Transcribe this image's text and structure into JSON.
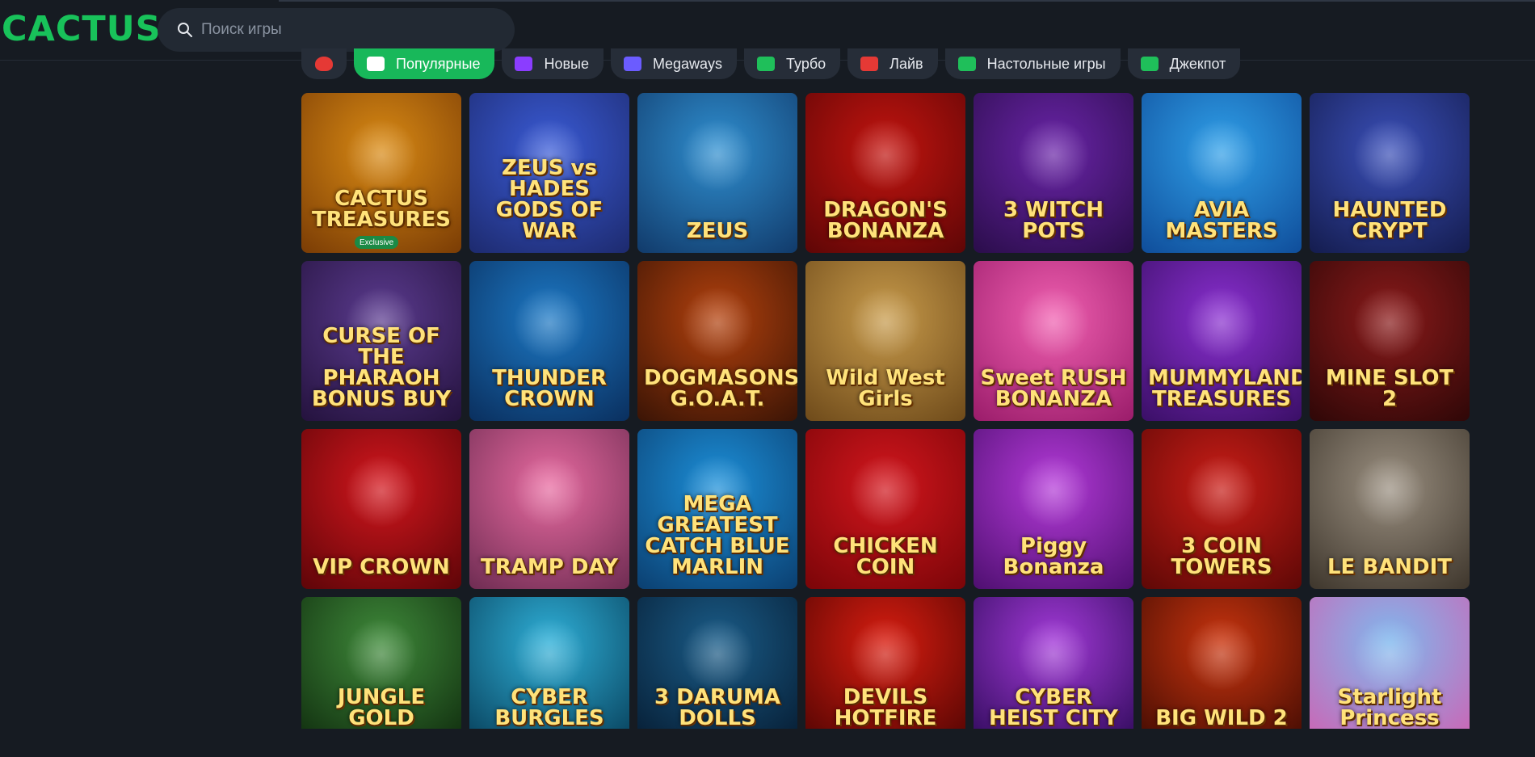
{
  "logo": {
    "text": "CACTUS"
  },
  "search": {
    "placeholder": "Поиск игры"
  },
  "colors": {
    "accent": "#18c25a",
    "background": "#161b22",
    "chip": "#262d38"
  },
  "categories": [
    {
      "label": "",
      "icon": "heart-icon",
      "color": "#e53935"
    },
    {
      "label": "Популярные",
      "icon": "trophy-icon",
      "color": "#ffffff",
      "active": true
    },
    {
      "label": "Новые",
      "icon": "sparkle-icon",
      "color": "#8b3dff"
    },
    {
      "label": "Megaways",
      "icon": "megaways-icon",
      "color": "#6b5cff"
    },
    {
      "label": "Турбо",
      "icon": "lightning-icon",
      "color": "#1fbf5a"
    },
    {
      "label": "Лайв",
      "icon": "live-icon",
      "color": "#e53935"
    },
    {
      "label": "Настольные игры",
      "icon": "chip-icon",
      "color": "#1fbf5a"
    },
    {
      "label": "Джекпот",
      "icon": "diamond-icon",
      "color": "#1fbf5a"
    }
  ],
  "games": [
    {
      "title": "CACTUS TREASURES",
      "badge": "Exclusive",
      "bg": "#d98a14",
      "bg2": "#7a3c05"
    },
    {
      "title": "ZEUS vs HADES GODS OF WAR",
      "bg": "#3a5bd6",
      "bg2": "#1d2a6e"
    },
    {
      "title": "ZEUS",
      "bg": "#2f8fd0",
      "bg2": "#113a6a"
    },
    {
      "title": "DRAGON'S BONANZA",
      "bg": "#c2140f",
      "bg2": "#5e0606"
    },
    {
      "title": "3 WITCH POTS",
      "bg": "#6a24a8",
      "bg2": "#2a0d4a"
    },
    {
      "title": "AVIA MASTERS",
      "bg": "#2f9fe8",
      "bg2": "#0f4d9a"
    },
    {
      "title": "HAUNTED CRYPT",
      "bg": "#3a4fb8",
      "bg2": "#141c4e"
    },
    {
      "title": "CURSE OF THE PHARAOH BONUS BUY",
      "bg": "#5b3b8f",
      "bg2": "#24123d"
    },
    {
      "title": "THUNDER CROWN",
      "bg": "#1c78c4",
      "bg2": "#0a2f5e"
    },
    {
      "title": "DOGMASONS G.O.A.T.",
      "bg": "#b3410d",
      "bg2": "#3a1405"
    },
    {
      "title": "Wild West Girls",
      "bg": "#c79a4a",
      "bg2": "#6e4a1a"
    },
    {
      "title": "Sweet RUSH BONANZA",
      "bg": "#f05fb0",
      "bg2": "#9a1c6a"
    },
    {
      "title": "MUMMYLAND TREASURES",
      "bg": "#8a2fd0",
      "bg2": "#3a0f66"
    },
    {
      "title": "MINE SLOT 2",
      "bg": "#8a1a1a",
      "bg2": "#2e0707"
    },
    {
      "title": "VIP CROWN",
      "bg": "#d2161d",
      "bg2": "#5e0508"
    },
    {
      "title": "TRAMP DAY",
      "bg": "#e86aa0",
      "bg2": "#6e2c52"
    },
    {
      "title": "MEGA GREATEST CATCH BLUE MARLIN",
      "bg": "#1c8fd8",
      "bg2": "#0b3f70"
    },
    {
      "title": "CHICKEN COIN",
      "bg": "#d2161d",
      "bg2": "#7a0508"
    },
    {
      "title": "Piggy Bonanza",
      "bg": "#b43ad8",
      "bg2": "#4e0f70"
    },
    {
      "title": "3 COIN TOWERS",
      "bg": "#c91d17",
      "bg2": "#5e0806"
    },
    {
      "title": "LE BANDIT",
      "bg": "#9a8f80",
      "bg2": "#3e362c"
    },
    {
      "title": "JUNGLE GOLD",
      "bg": "#3f8a3a",
      "bg2": "#143512"
    },
    {
      "title": "CYBER BURGLES",
      "bg": "#2fb0d8",
      "bg2": "#0b4a66"
    },
    {
      "title": "3 DARUMA DOLLS",
      "bg": "#1a5c88",
      "bg2": "#08223a"
    },
    {
      "title": "DEVILS HOTFIRE",
      "bg": "#d81d10",
      "bg2": "#5e0704"
    },
    {
      "title": "CYBER HEIST CITY",
      "bg": "#a33ad8",
      "bg2": "#3a0f66"
    },
    {
      "title": "BIG WILD 2",
      "bg": "#c9340e",
      "bg2": "#4e0f04"
    },
    {
      "title": "Starlight Princess",
      "bg": "#7fb8ee",
      "bg2": "#c76ab8"
    }
  ]
}
